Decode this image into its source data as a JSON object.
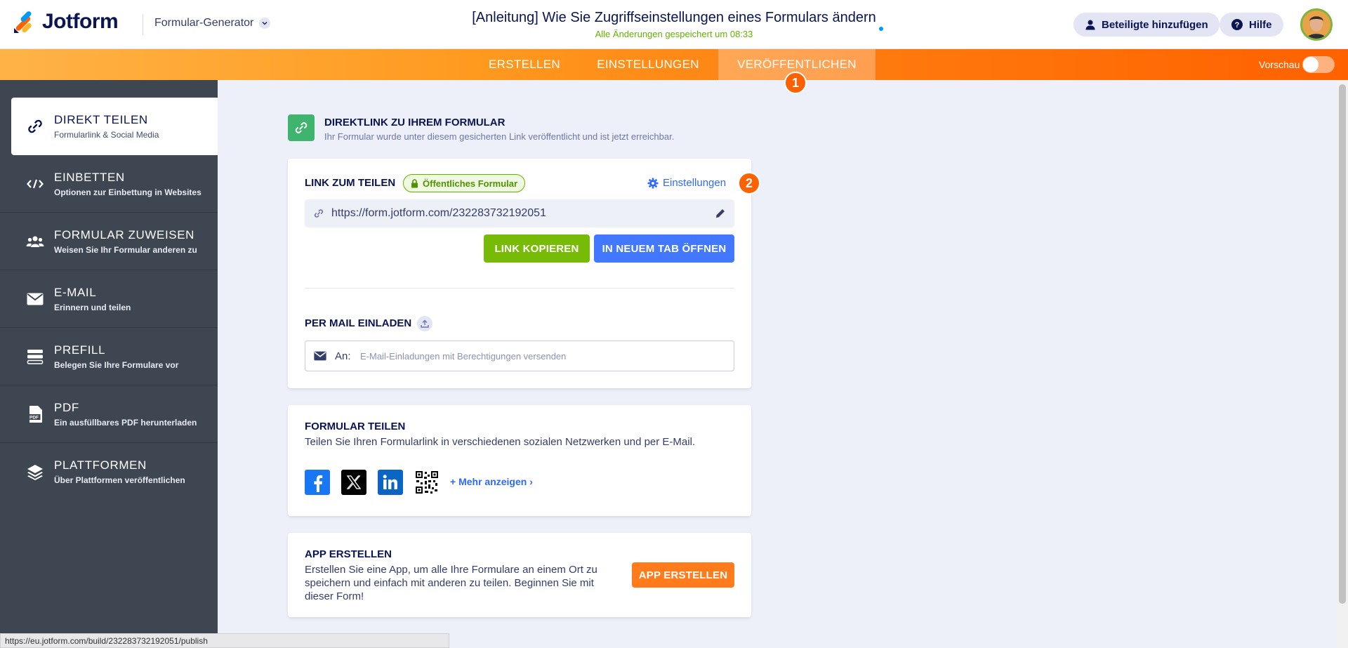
{
  "header": {
    "logo_text": "Jotform",
    "generator_label": "Formular-Generator",
    "title": "[Anleitung] Wie Sie Zugriffseinstellungen eines Formulars ändern",
    "saved_status": "Alle Änderungen gespeichert um 08:33",
    "add_participants": "Beteiligte hinzufügen",
    "help": "Hilfe"
  },
  "nav": {
    "tabs": [
      {
        "label": "ERSTELLEN"
      },
      {
        "label": "EINSTELLUNGEN"
      },
      {
        "label": "VERÖFFENTLICHEN"
      }
    ],
    "active_tab": "VERÖFFENTLICHEN",
    "preview_label": "Vorschau",
    "preview_on": false
  },
  "steps": {
    "one": "1",
    "two": "2"
  },
  "sidebar": {
    "items": [
      {
        "title": "DIREKT TEILEN",
        "sub": "Formularlink & Social Media",
        "icon": "link-icon"
      },
      {
        "title": "EINBETTEN",
        "sub": "Optionen zur Einbettung in Websites",
        "icon": "code-icon"
      },
      {
        "title": "FORMULAR ZUWEISEN",
        "sub": "Weisen Sie Ihr Formular anderen zu",
        "icon": "users-icon"
      },
      {
        "title": "E-MAIL",
        "sub": "Erinnern und teilen",
        "icon": "envelope-icon"
      },
      {
        "title": "PREFILL",
        "sub": "Belegen Sie Ihre Formulare vor",
        "icon": "prefill-icon"
      },
      {
        "title": "PDF",
        "sub": "Ein ausfüllbares PDF herunterladen",
        "icon": "pdf-icon"
      },
      {
        "title": "PLATTFORMEN",
        "sub": "Über Plattformen veröffentlichen",
        "icon": "layers-icon"
      }
    ]
  },
  "direct": {
    "title": "DIREKTLINK ZU IHREM FORMULAR",
    "sub": "Ihr Formular wurde unter diesem gesicherten Link veröffentlicht und ist jetzt erreichbar."
  },
  "share_link": {
    "title": "LINK ZUM TEILEN",
    "badge": "Öffentliches Formular",
    "settings": "Einstellungen",
    "url": "https://form.jotform.com/232283732192051",
    "copy_button": "LINK KOPIEREN",
    "open_button": "IN NEUEM TAB ÖFFNEN"
  },
  "mail_invite": {
    "title": "PER MAIL EINLADEN",
    "to_label": "An:",
    "placeholder": "E-Mail-Einladungen mit Berechtigungen versenden"
  },
  "share_form": {
    "title": "FORMULAR TEILEN",
    "sub": "Teilen Sie Ihren Formularlink in verschiedenen sozialen Netzwerken und per E-Mail.",
    "more": "+ Mehr anzeigen ›"
  },
  "app": {
    "title": "APP ERSTELLEN",
    "sub": "Erstellen Sie eine App, um alle Ihre Formulare an einem Ort zu speichern und einfach mit anderen zu teilen. Beginnen Sie mit dieser Form!",
    "button": "APP ERSTELLEN"
  },
  "status_bar": "https://eu.jotform.com/build/232283732192051/publish",
  "colors": {
    "brand_orange": "#ff6100",
    "sidebar_bg": "#3e4652",
    "green": "#78bb07",
    "blue": "#4277ff",
    "app_orange": "#ff7b1c"
  }
}
